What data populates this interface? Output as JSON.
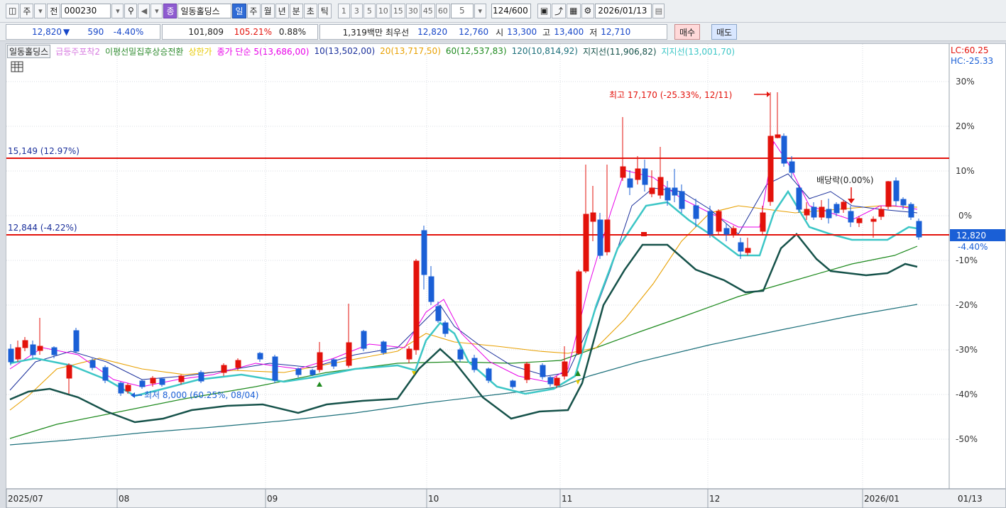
{
  "toolbar": {
    "market_label": "주",
    "type_label": "전",
    "code": "000230",
    "stock_button": "종",
    "stock_name": "일동홀딩스",
    "periods": [
      "일",
      "주",
      "월",
      "년",
      "분",
      "초",
      "틱"
    ],
    "active_period": "일",
    "minute_options": [
      "1",
      "3",
      "5",
      "10",
      "15",
      "30",
      "45",
      "60"
    ],
    "count_value": "5",
    "bar_count": "124",
    "bar_total": "/600",
    "date": "2026/01/13"
  },
  "info": {
    "price": "12,820",
    "arrow": "▼",
    "change": "590",
    "change_pct": "-4.40%",
    "volume": "101,809",
    "volume_ratio": "105.21%",
    "turnover": "0.88%",
    "amount": "1,319백만",
    "best_label": "최우선",
    "best_sell": "12,820",
    "best_buy": "12,760",
    "open_label": "시",
    "open": "13,300",
    "high_label": "고",
    "high": "13,400",
    "low_label": "저",
    "low": "12,710",
    "buy_button": "매수",
    "sell_button": "매도"
  },
  "legend": {
    "name": "일동홀딩스",
    "items": [
      {
        "text": "급등주포착2",
        "color": "#d77be0"
      },
      {
        "text": "이평선밀집후상승전환",
        "color": "#2e8b2e"
      },
      {
        "text": "상한가",
        "color": "#e6c800"
      },
      {
        "text": "종가 단순 5(13,686,00)",
        "color": "#e800e8"
      },
      {
        "text": "10(13,502,00)",
        "color": "#1a2f9b"
      },
      {
        "text": "20(13,717,50)",
        "color": "#e8a000"
      },
      {
        "text": "60(12,537,83)",
        "color": "#1e8a1e"
      },
      {
        "text": "120(10,814,92)",
        "color": "#1b6f7a"
      },
      {
        "text": "지지선(11,906,82)",
        "color": "#16524a"
      },
      {
        "text": "지지선(13,001,70)",
        "color": "#3cc6c6"
      }
    ]
  },
  "right_labels": {
    "lc": "LC:60.25",
    "hc": "HC:-25.33",
    "price_tag": "12,820",
    "pct_tag": "-4.40%"
  },
  "y_ticks": [
    "30%",
    "20%",
    "10%",
    "0%",
    "-10%",
    "-20%",
    "-30%",
    "-40%",
    "-50%"
  ],
  "x_ticks": [
    "2025/07",
    "08",
    "09",
    "10",
    "11",
    "12",
    "2026/01",
    "01/13"
  ],
  "lines": {
    "upper_label": "15,149 (12.97%)",
    "lower_label": "12,844 (-4.22%)"
  },
  "annotations": {
    "high": "최고 17,170 (-25.33%, 12/11)",
    "low": "최저 8,000 (60.25%, 08/04)",
    "dividend": "배당락(0.00%)"
  },
  "colors": {
    "up": "#e3120b",
    "down": "#1a5fd6",
    "ref_line": "#e3120b",
    "ma5": "#e800e8",
    "ma10": "#1a2f9b",
    "ma20": "#e8a000",
    "ma60": "#1e8a1e",
    "ma120": "#1b6f7a",
    "support1": "#16524a",
    "support2": "#3cc6c6"
  }
}
